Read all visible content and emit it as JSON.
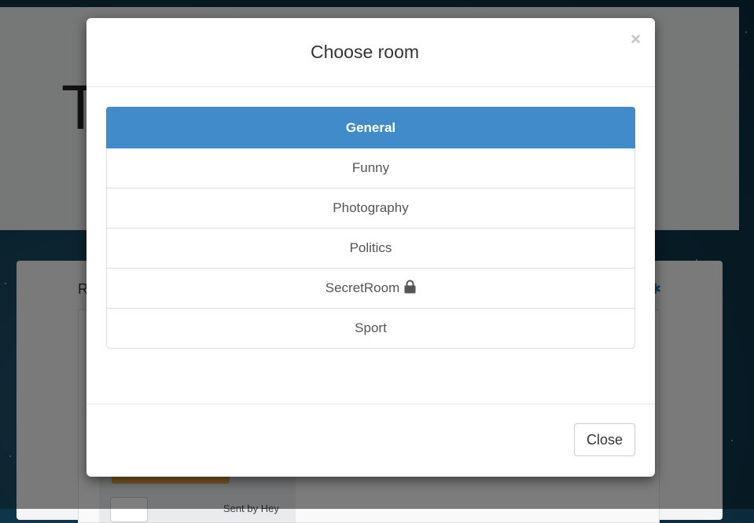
{
  "background_page": {
    "jumbotron_title_start": "T",
    "jumbotron_title_end": "!",
    "panel_label": "R",
    "sent_by": "Sent by Hey"
  },
  "modal": {
    "title": "Choose room",
    "close_icon": "×",
    "rooms": [
      {
        "label": "General",
        "active": true
      },
      {
        "label": "Funny"
      },
      {
        "label": "Photography"
      },
      {
        "label": "Politics"
      },
      {
        "label": "SecretRoom",
        "icon": "lock-icon"
      },
      {
        "label": "Sport"
      }
    ],
    "close_button": "Close"
  },
  "colors": {
    "accent": "#428bca"
  }
}
